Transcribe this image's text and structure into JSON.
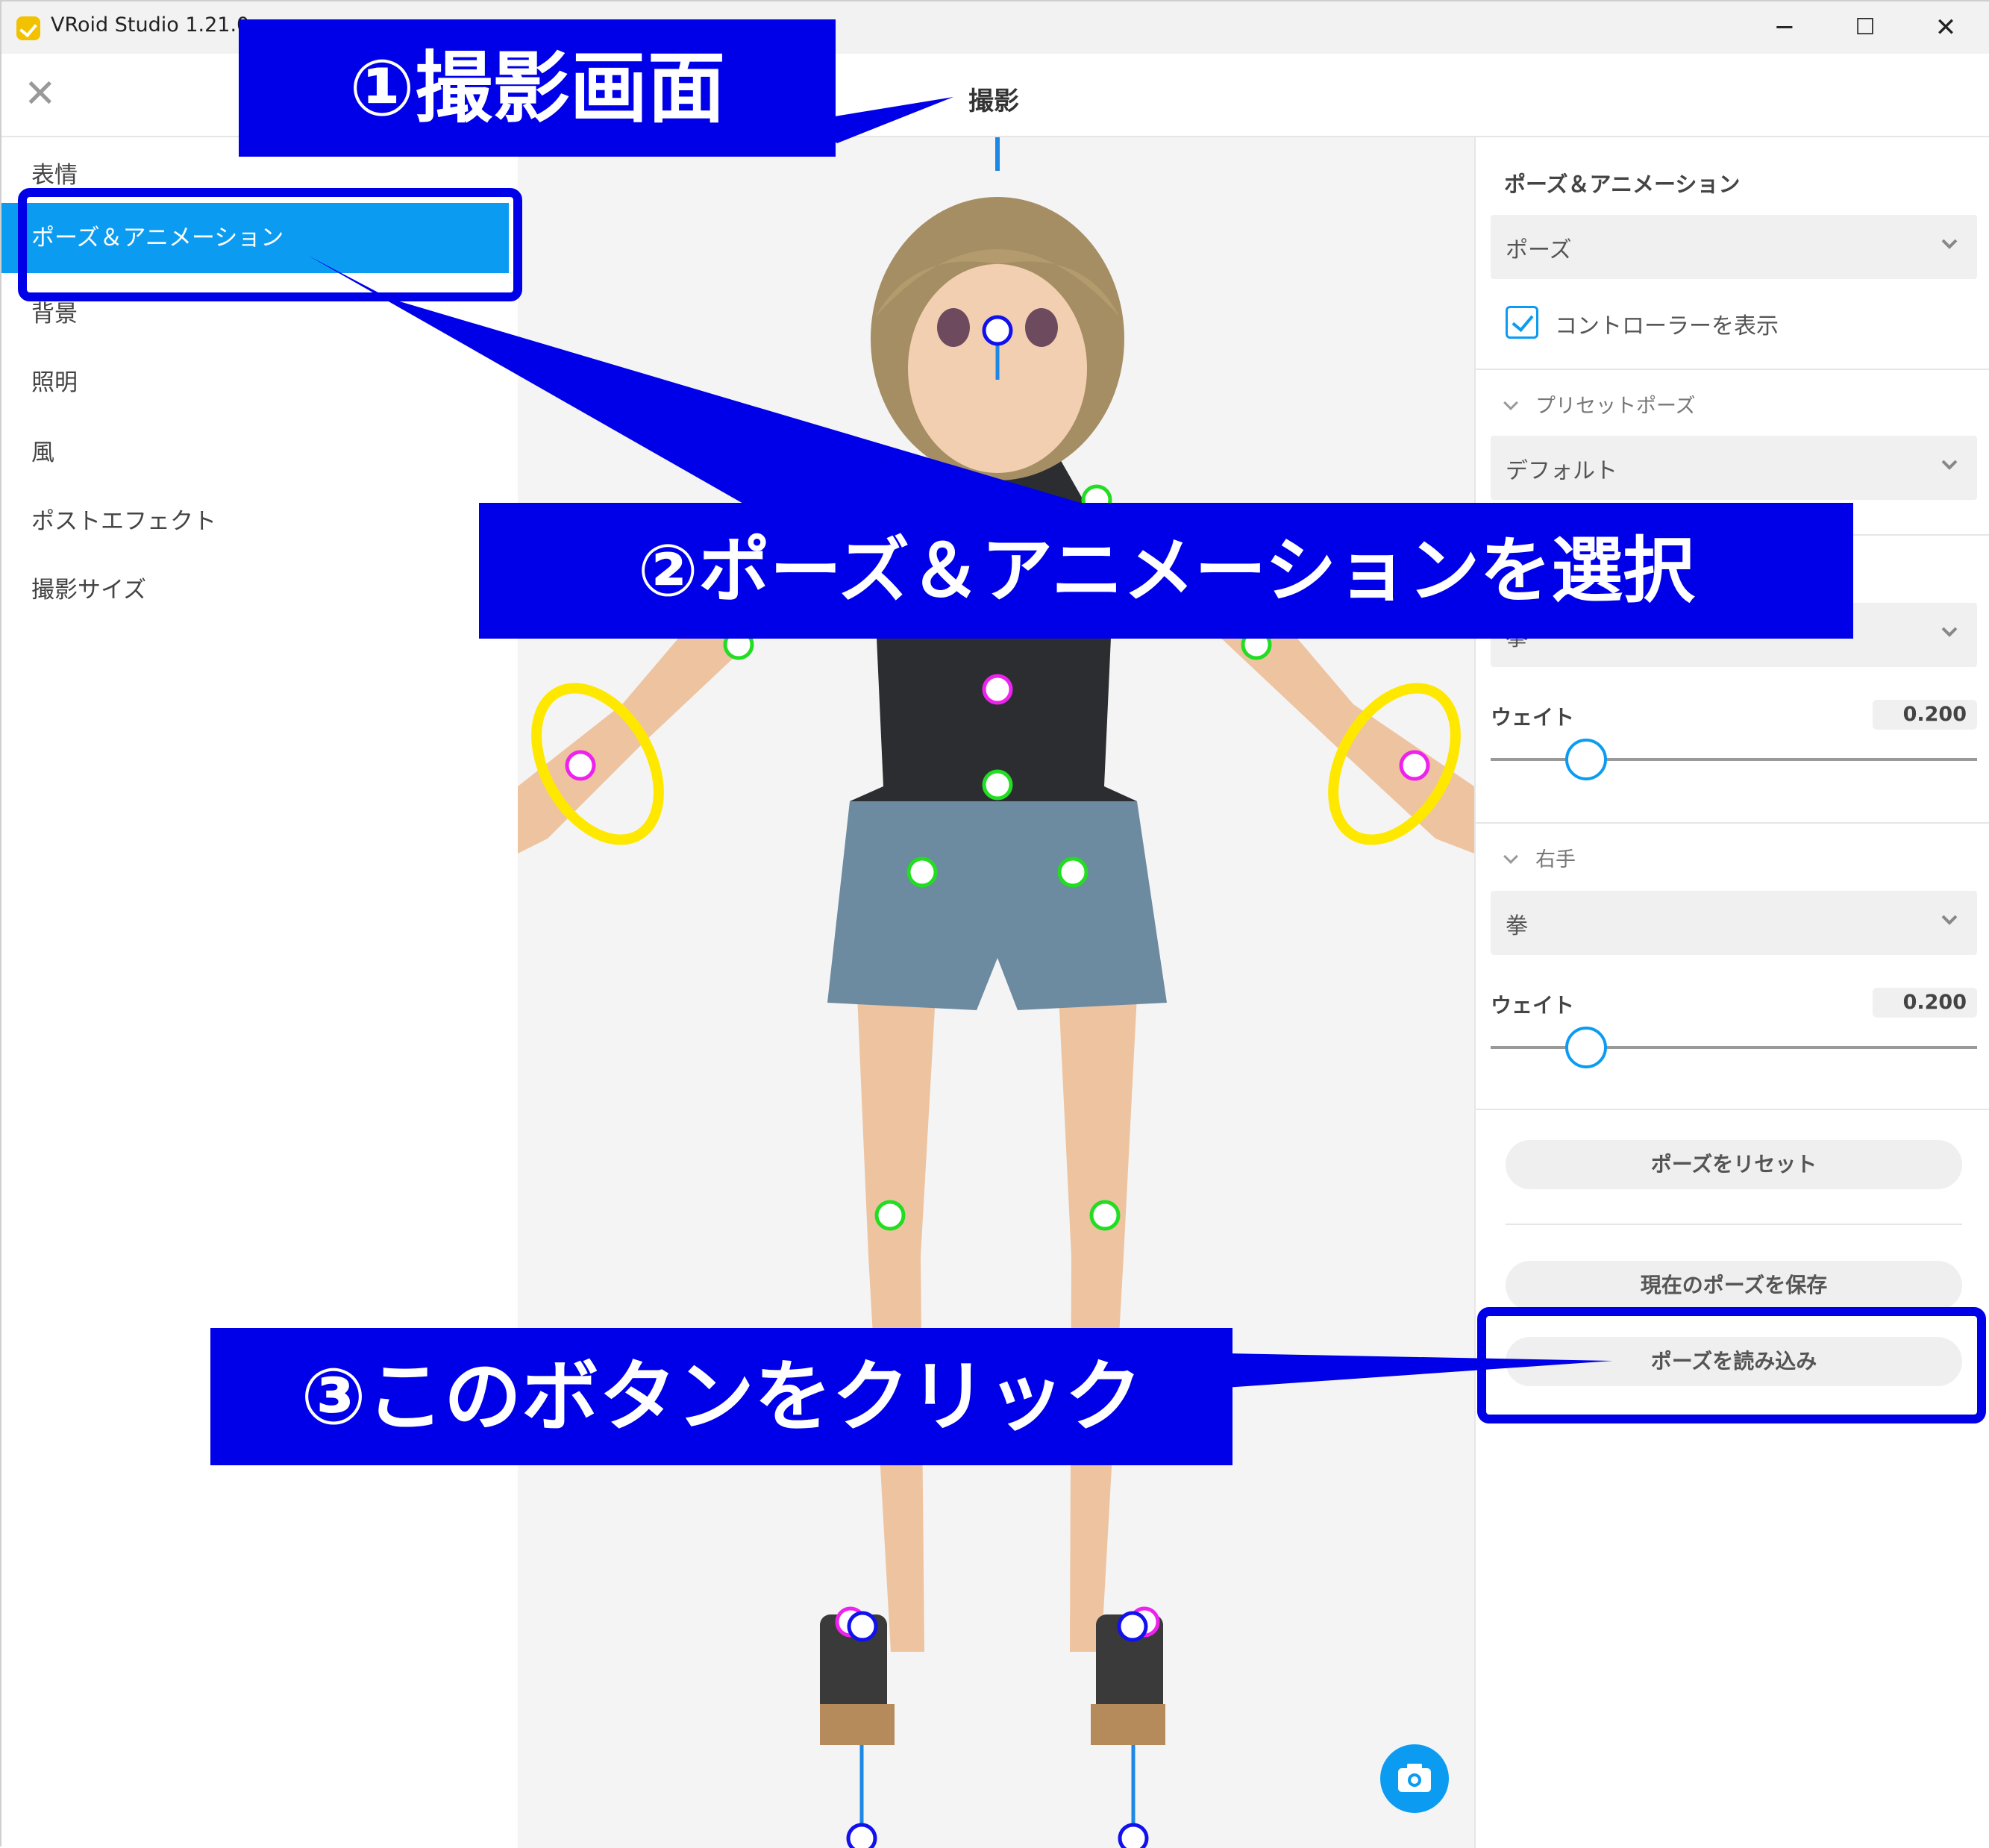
{
  "window": {
    "title": "VRoid Studio 1.21.0 -",
    "controls": {
      "minimize": "─",
      "maximize": "☐",
      "close": "✕"
    }
  },
  "header": {
    "close_icon": "✕",
    "title": "撮影"
  },
  "sidebar": {
    "items": [
      {
        "label": "表情"
      },
      {
        "label": "ポーズ＆アニメーション"
      },
      {
        "label": "背景"
      },
      {
        "label": "照明"
      },
      {
        "label": "風"
      },
      {
        "label": "ポストエフェクト"
      },
      {
        "label": "撮影サイズ"
      }
    ],
    "active_index": 1
  },
  "panel": {
    "heading": "ポーズ＆アニメーション",
    "mode_select": "ポーズ",
    "show_controller": {
      "label": "コントローラーを表示",
      "checked": true
    },
    "preset_section": "プリセットポーズ",
    "preset_select": "デフォルト",
    "left_hand": {
      "select": "拳",
      "weight_label": "ウェイト",
      "weight_value": "0.200",
      "weight": 0.2
    },
    "right_hand_section": "右手",
    "right_hand": {
      "select": "拳",
      "weight_label": "ウェイト",
      "weight_value": "0.200",
      "weight": 0.2
    },
    "buttons": {
      "reset": "ポーズをリセット",
      "save": "現在のポーズを保存",
      "load": "ポーズを読み込み"
    }
  },
  "callouts": {
    "c1": "①撮影画面",
    "c2": "②ポーズ＆アニメーションを選択",
    "c3": "③このボタンをクリック"
  },
  "colors": {
    "accent": "#0b9cf2",
    "callout": "#0000e8",
    "handle_green": "#22dd22",
    "handle_magenta": "#ee22ee",
    "handle_blue": "#1111ee",
    "ring_yellow": "#ffe800"
  },
  "icons": {
    "camera": "camera-icon",
    "app": "vroid-logo-icon"
  }
}
